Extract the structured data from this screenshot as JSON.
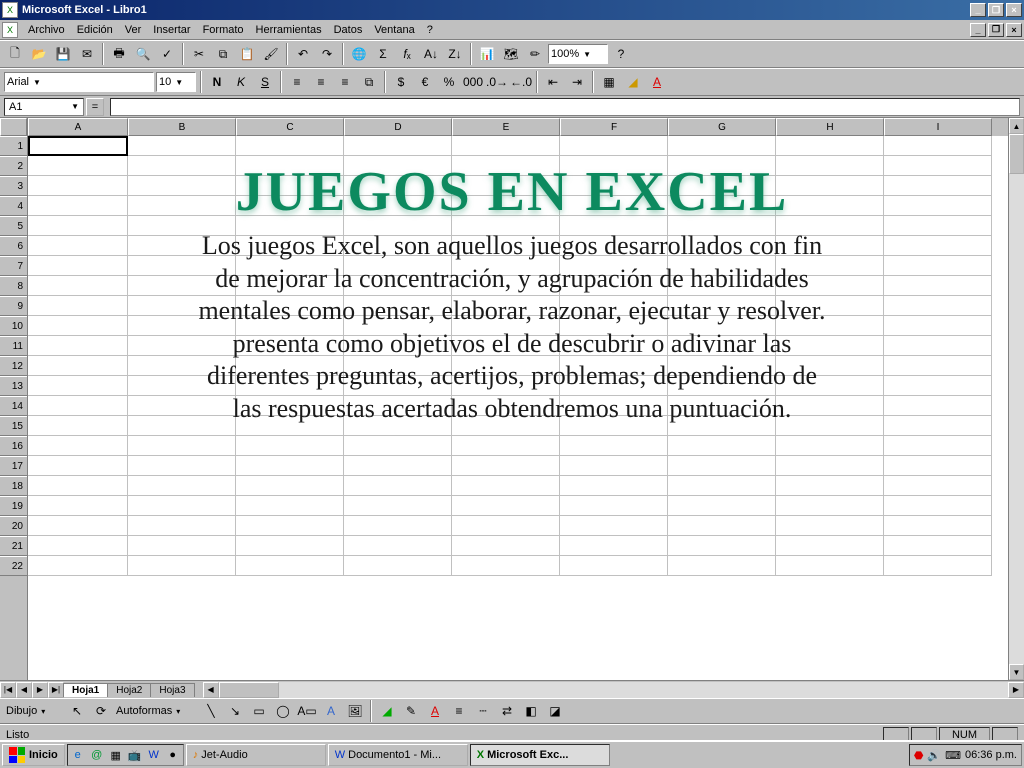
{
  "titlebar": {
    "app": "Microsoft Excel",
    "doc": "Libro1"
  },
  "menu": {
    "archivo": "Archivo",
    "edicion": "Edición",
    "ver": "Ver",
    "insertar": "Insertar",
    "formato": "Formato",
    "herramientas": "Herramientas",
    "datos": "Datos",
    "ventana": "Ventana",
    "ayuda": "?"
  },
  "toolbar": {
    "zoom": "100%",
    "font": "Arial",
    "fontsize": "10"
  },
  "cellref": "A1",
  "columns": [
    "A",
    "B",
    "C",
    "D",
    "E",
    "F",
    "G",
    "H",
    "I"
  ],
  "rows_start": 1,
  "rows_end": 22,
  "sheets": {
    "s1": "Hoja1",
    "s2": "Hoja2",
    "s3": "Hoja3"
  },
  "drawbar": {
    "label": "Dibujo",
    "autoshapes": "Autoformas"
  },
  "status": {
    "ready": "Listo",
    "num": "NUM"
  },
  "overlay": {
    "title": "JUEGOS EN EXCEL",
    "body": "Los juegos Excel, son aquellos juegos desarrollados con fin de mejorar la concentración, y agrupación de habilidades mentales como pensar, elaborar, razonar, ejecutar y resolver. presenta como objetivos el de descubrir o adivinar las diferentes preguntas, acertijos, problemas; dependiendo de las respuestas acertadas obtendremos una puntuación."
  },
  "taskbar": {
    "start": "Inicio",
    "items": {
      "jet": "Jet-Audio",
      "doc": "Documento1 - Mi...",
      "excel": "Microsoft Exc..."
    },
    "clock": "06:36 p.m."
  }
}
